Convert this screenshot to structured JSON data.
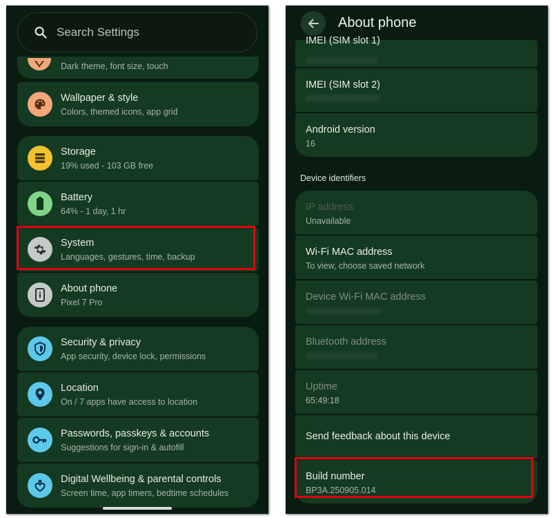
{
  "left_screen": {
    "search": {
      "placeholder": "Search Settings",
      "icon": "search-icon"
    },
    "items": [
      {
        "id": "display",
        "title": "",
        "subtitle": "Dark theme, font size, touch",
        "icon": "display-icon",
        "icon_color": "#f0a878"
      },
      {
        "id": "wallpaper",
        "title": "Wallpaper & style",
        "subtitle": "Colors, themed icons, app grid",
        "icon": "palette-icon",
        "icon_color": "#f4a57a"
      },
      {
        "id": "storage",
        "title": "Storage",
        "subtitle": "19% used - 103 GB free",
        "icon": "storage-icon",
        "icon_color": "#f2c230"
      },
      {
        "id": "battery",
        "title": "Battery",
        "subtitle": "64% - 1 day, 1 hr",
        "icon": "battery-icon",
        "icon_color": "#7ed487"
      },
      {
        "id": "system",
        "title": "System",
        "subtitle": "Languages, gestures, time, backup",
        "icon": "gear-icon",
        "icon_color": "#c4cac5"
      },
      {
        "id": "about",
        "title": "About phone",
        "subtitle": "Pixel 7 Pro",
        "icon": "phone-info-icon",
        "icon_color": "#c4cac5"
      },
      {
        "id": "security",
        "title": "Security & privacy",
        "subtitle": "App security, device lock, permissions",
        "icon": "shield-icon",
        "icon_color": "#5dc9ea"
      },
      {
        "id": "location",
        "title": "Location",
        "subtitle": "On / 7 apps have access to location",
        "icon": "location-pin-icon",
        "icon_color": "#5dc9ea"
      },
      {
        "id": "passwords",
        "title": "Passwords, passkeys & accounts",
        "subtitle": "Suggestions for sign-in & autofill",
        "icon": "key-icon",
        "icon_color": "#5dc9ea"
      },
      {
        "id": "wellbeing",
        "title": "Digital Wellbeing & parental controls",
        "subtitle": "Screen time, app timers, bedtime schedules",
        "icon": "wellbeing-icon",
        "icon_color": "#5dc9ea"
      }
    ]
  },
  "right_screen": {
    "title": "About phone",
    "section_label": "Device identifiers",
    "items": [
      {
        "id": "imei1",
        "title": "IMEI (SIM slot 1)",
        "subtitle": ""
      },
      {
        "id": "imei2",
        "title": "IMEI (SIM slot 2)",
        "subtitle": ""
      },
      {
        "id": "android",
        "title": "Android version",
        "subtitle": "16"
      },
      {
        "id": "ip",
        "title": "IP address",
        "subtitle": "Unavailable"
      },
      {
        "id": "wifimac",
        "title": "Wi-Fi MAC address",
        "subtitle": "To view, choose saved network"
      },
      {
        "id": "devwifimac",
        "title": "Device Wi-Fi MAC address",
        "subtitle": ""
      },
      {
        "id": "bt",
        "title": "Bluetooth address",
        "subtitle": ""
      },
      {
        "id": "uptime",
        "title": "Uptime",
        "subtitle": "65:49:18"
      },
      {
        "id": "feedback",
        "title": "Send feedback about this device",
        "subtitle": ""
      },
      {
        "id": "build",
        "title": "Build number",
        "subtitle": "BP3A.250905.014"
      }
    ]
  },
  "colors": {
    "card_bg": "#153a22",
    "screen_bg": "#0a1c12",
    "highlight": "#e3000f"
  }
}
